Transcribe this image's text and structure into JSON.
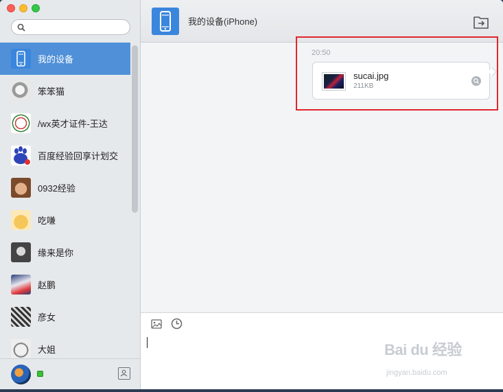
{
  "window": {
    "colors": {
      "accent": "#4f90d8",
      "device_icon": "#3a86dd",
      "highlight": "#e0262b"
    }
  },
  "sidebar": {
    "search": {
      "placeholder": ""
    },
    "contacts": [
      {
        "name": "我的设备",
        "active": true,
        "icon": "phone-icon"
      },
      {
        "name": "笨笨猫"
      },
      {
        "name": "/wx英才证件-王达"
      },
      {
        "name": "百度经验回享计划交"
      },
      {
        "name": "0932经验"
      },
      {
        "name": "吃嗛"
      },
      {
        "name": "缘来是你"
      },
      {
        "name": "赵鹏"
      },
      {
        "name": "彦女"
      },
      {
        "name": "大姐"
      }
    ],
    "status": "online"
  },
  "header": {
    "title": "我的设备(iPhone)",
    "icon": "phone-icon",
    "send_file_icon": "send-file-icon"
  },
  "chat": {
    "timestamp": "20:50",
    "message": {
      "file_name": "sucai.jpg",
      "file_size": "211KB",
      "preview_icon": "search-icon"
    }
  },
  "composer": {
    "tools": [
      "image-icon",
      "clock-icon"
    ]
  },
  "watermark": {
    "text": "Bai du 经验",
    "sub": "jingyan.baidu.com"
  }
}
